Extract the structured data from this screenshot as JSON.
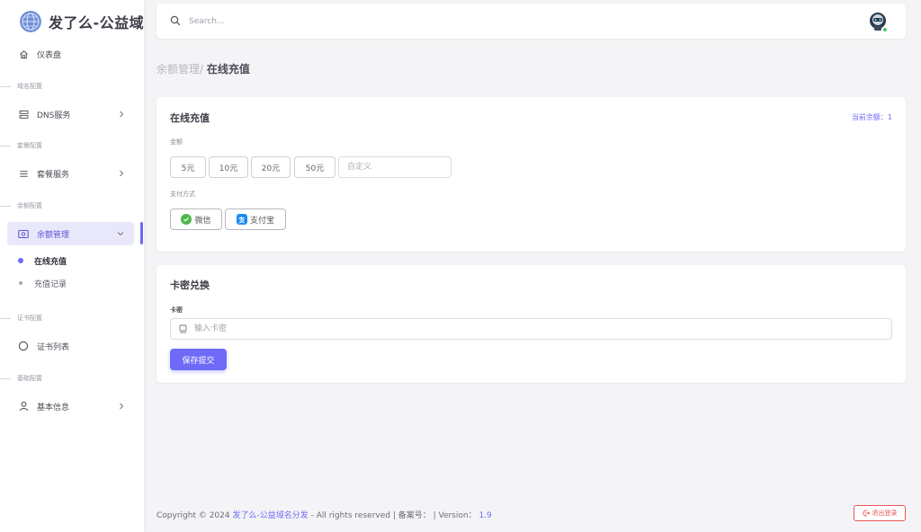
{
  "brand": {
    "name": "发了么-公益域"
  },
  "sidebar": {
    "dashboard": "仪表盘",
    "sections": {
      "domain": "域名配置",
      "package": "套餐配置",
      "balance": "余额配置",
      "cert": "证书配置",
      "basic": "基础配置"
    },
    "dns": "DNS服务",
    "package_service": "套餐服务",
    "balance_mgmt": "余额管理",
    "sub_online": "在线充值",
    "sub_records": "充值记录",
    "cert_list": "证书列表",
    "basic_info": "基本信息"
  },
  "topbar": {
    "search_placeholder": "Search..."
  },
  "breadcrumb": {
    "parent": "余额管理/",
    "current": "在线充值"
  },
  "recharge": {
    "title": "在线充值",
    "balance_text": "当前余额：1",
    "amount_label": "金额",
    "amounts": [
      "5元",
      "10元",
      "20元",
      "50元"
    ],
    "custom_placeholder": "自定义",
    "pay_label": "支付方式",
    "pay_wechat": "微信",
    "pay_alipay": "支付宝"
  },
  "redeem": {
    "title": "卡密兑换",
    "field_label": "卡密",
    "placeholder": "输入卡密",
    "submit": "保存提交"
  },
  "footer": {
    "copyright": "Copyright © 2024",
    "site": "发了么-公益域名分发",
    "rights": "- All rights reserved | 备案号： | Version：",
    "version": "1.9",
    "logout": "退出登录"
  },
  "colors": {
    "accent": "#6f6af8",
    "danger": "#ea5455",
    "online": "#4bc76a"
  }
}
